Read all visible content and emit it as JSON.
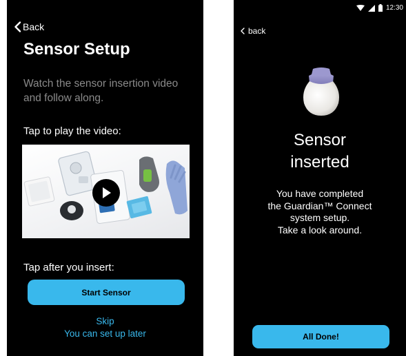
{
  "left_screen": {
    "back_label": "Back",
    "title": "Sensor Setup",
    "description": "Watch the sensor insertion video and follow along.",
    "play_prompt": "Tap to play the video:",
    "insert_prompt": "Tap after you insert:",
    "start_button": "Start Sensor",
    "skip_link": "Skip",
    "later_link": "You can set up later"
  },
  "right_screen": {
    "status_time": "12:30",
    "back_label": "back",
    "title_line1": "Sensor",
    "title_line2": "inserted",
    "desc_line1": "You have completed",
    "desc_line2": "the Guardian™ Connect",
    "desc_line3": "system setup.",
    "desc_line4": "Take a look around.",
    "done_button": "All Done!"
  },
  "icons": {
    "back": "chevron-left-icon",
    "play": "play-icon",
    "wifi": "wifi-icon",
    "signal": "signal-icon",
    "battery": "battery-icon"
  },
  "colors": {
    "accent": "#39b8ec",
    "background": "#000000",
    "muted_text": "#8a8a8a"
  }
}
